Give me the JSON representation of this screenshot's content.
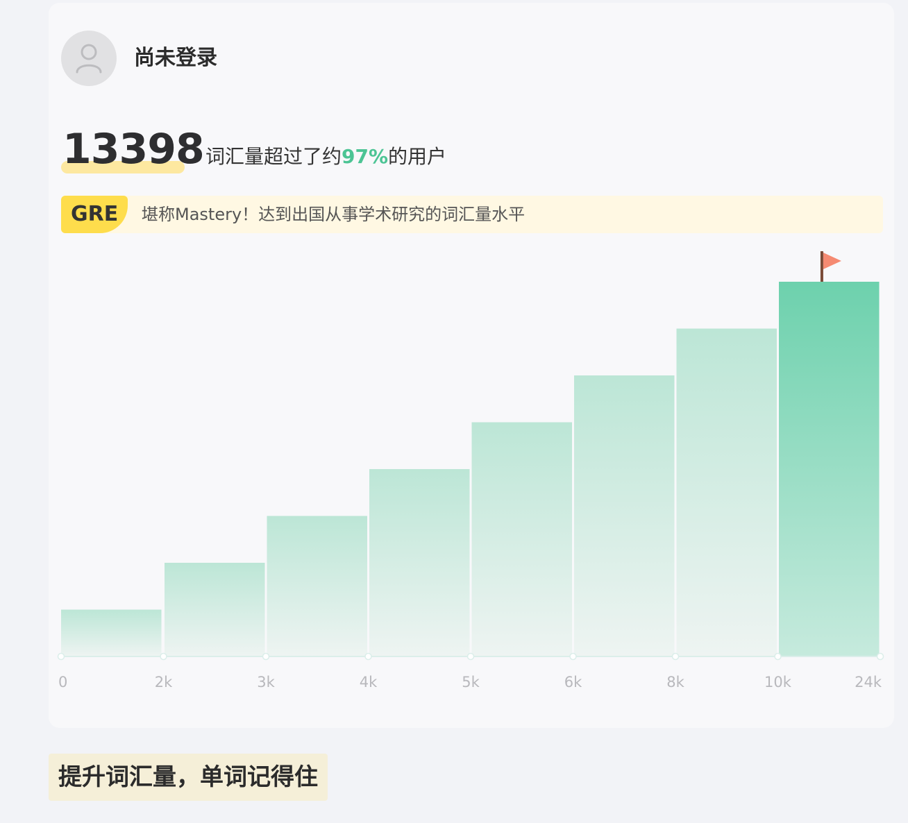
{
  "user": {
    "status": "尚未登录"
  },
  "vocab": {
    "count": "13398",
    "summary_prefix": "词汇量超过了约",
    "percentile": "97%",
    "summary_suffix": "的用户"
  },
  "level": {
    "badge": "GRE",
    "description": "堪称Mastery！达到出国从事学术研究的词汇量水平"
  },
  "chart_data": {
    "type": "bar",
    "x_ticks": [
      "0",
      "2k",
      "3k",
      "4k",
      "5k",
      "6k",
      "8k",
      "10k",
      "24k"
    ],
    "categories": [
      "0-2k",
      "2k-3k",
      "3k-4k",
      "4k-5k",
      "5k-6k",
      "6k-8k",
      "8k-10k",
      "10k-24k"
    ],
    "values": [
      1,
      2,
      3,
      4,
      5,
      6,
      7,
      8
    ],
    "ylim": [
      0,
      8
    ],
    "highlight_index": 7,
    "colors": {
      "bar_top": "#bce6d6",
      "bar_bottom": "#eef4f2",
      "highlight_top": "#6dd1ad",
      "highlight_bottom": "#c6eadd",
      "axis": "#dbeeea",
      "flag": "#f58a72",
      "flag_pole": "#7a4a36"
    }
  },
  "promo": {
    "text": "提升词汇量，单词记得住"
  }
}
